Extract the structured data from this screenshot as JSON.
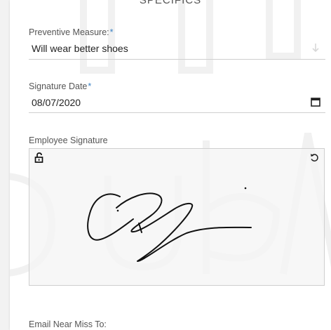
{
  "section": {
    "title": "SPECIFICS"
  },
  "preventive_measure": {
    "label": "Preventive Measure:",
    "required_marker": "*",
    "value": "Will wear better shoes"
  },
  "signature_date": {
    "label": "Signature Date",
    "required_marker": "*",
    "value": "08/07/2020"
  },
  "employee_signature": {
    "label": "Employee Signature"
  },
  "email_near_miss": {
    "label": "Email Near Miss To:"
  },
  "colors": {
    "required": "#3b82c4",
    "label": "#555555",
    "field_line": "#cfcfcf"
  }
}
